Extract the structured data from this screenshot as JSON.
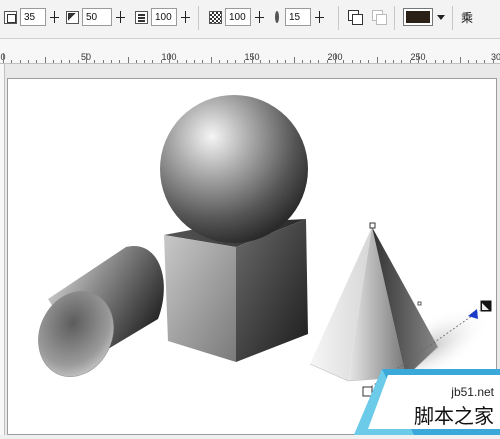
{
  "toolbar": {
    "field1": "35",
    "field2": "50",
    "field3": "100",
    "field4": "100",
    "field5": "15",
    "fill_color": "#2b2015",
    "mode_label": "乘"
  },
  "ruler": {
    "labels": [
      "0",
      "50",
      "100",
      "150",
      "200",
      "250",
      "30"
    ]
  },
  "watermark": {
    "url": "jb51.net",
    "name": "脚本之家"
  }
}
